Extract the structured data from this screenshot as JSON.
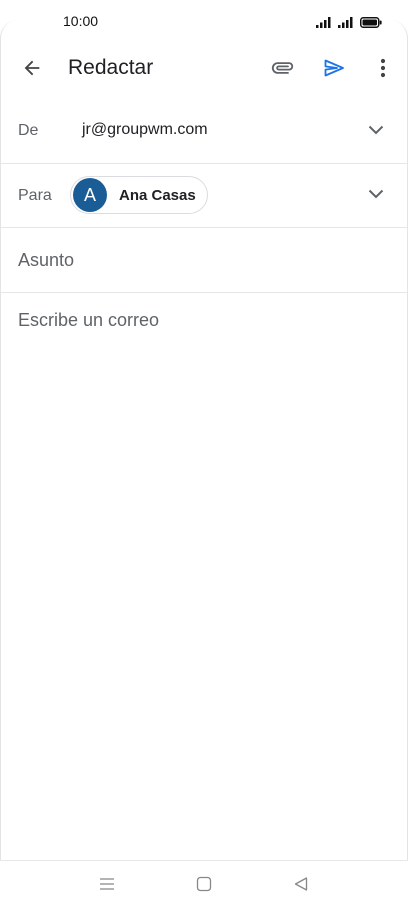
{
  "status_bar": {
    "time": "10:00",
    "icons": [
      "signal-icon",
      "signal-icon",
      "battery-icon"
    ]
  },
  "app_bar": {
    "title": "Redactar",
    "icons": [
      "back-arrow-icon",
      "paperclip-icon",
      "send-icon",
      "more-vert-icon"
    ]
  },
  "compose": {
    "from": {
      "label": "De",
      "value": "jr@groupwm.com"
    },
    "to": {
      "label": "Para",
      "recipient": {
        "initial": "A",
        "name": "Ana Casas"
      }
    },
    "subject": {
      "placeholder": "Asunto",
      "value": ""
    },
    "body": {
      "placeholder": "Escribe un correo",
      "value": ""
    }
  },
  "nav_bar": {
    "icons": [
      "menu-icon",
      "home-icon",
      "back-icon"
    ]
  },
  "colors": {
    "accent": "#1a73e8",
    "avatar": "#1a5d96",
    "label_gray": "#5f6368",
    "divider": "#e6e6e6"
  }
}
